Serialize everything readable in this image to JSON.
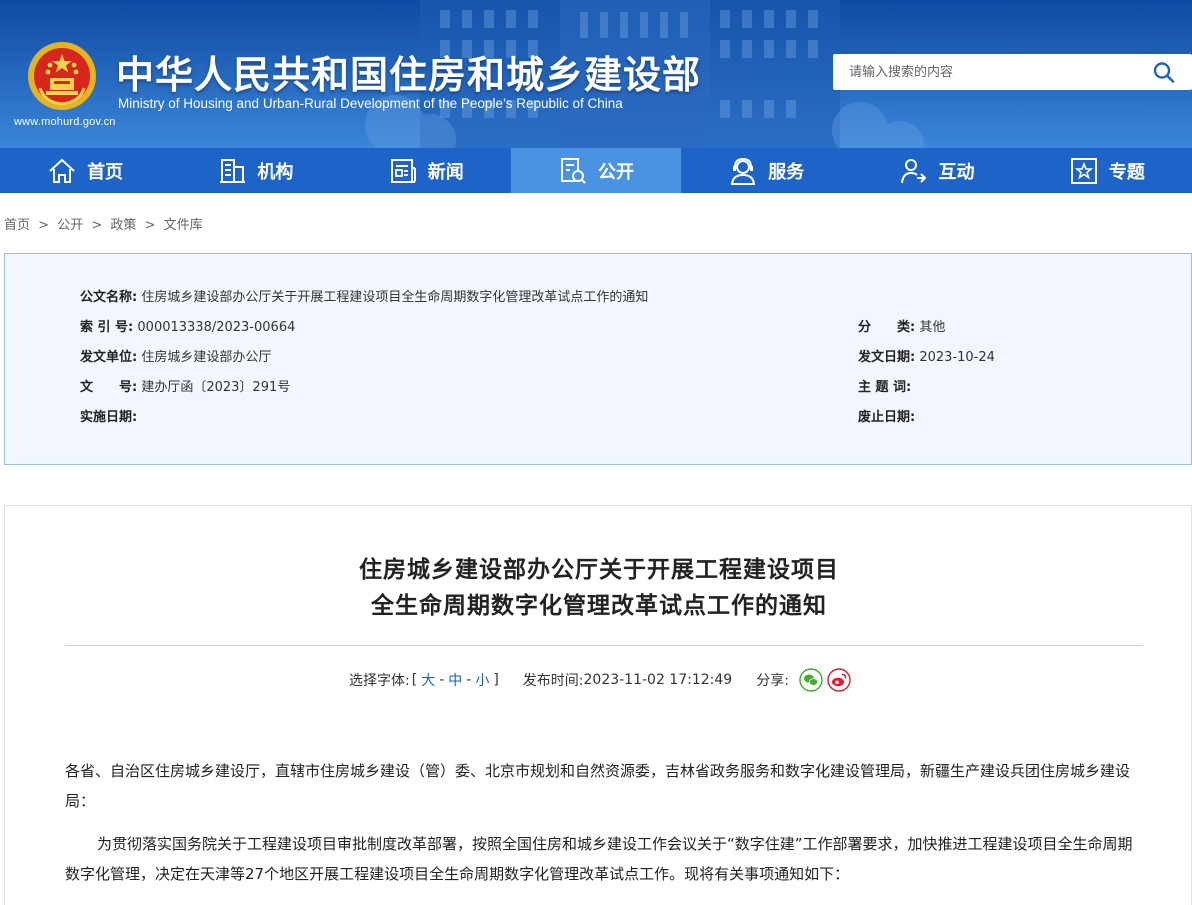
{
  "header": {
    "title_cn": "中华人民共和国住房和城乡建设部",
    "title_en": "Ministry of Housing and Urban-Rural Development of the People’s Republic of China",
    "site_url": "www.mohurd.gov.cn",
    "search_placeholder": "请输入搜索的内容"
  },
  "nav": {
    "items": [
      {
        "label": "首页",
        "icon": "home-icon"
      },
      {
        "label": "机构",
        "icon": "building-icon"
      },
      {
        "label": "新闻",
        "icon": "newspaper-icon"
      },
      {
        "label": "公开",
        "icon": "document-search-icon",
        "active": true
      },
      {
        "label": "服务",
        "icon": "service-person-icon"
      },
      {
        "label": "互动",
        "icon": "interaction-person-icon"
      },
      {
        "label": "专题",
        "icon": "star-box-icon"
      }
    ]
  },
  "breadcrumb": [
    "首页",
    ">",
    "公开",
    ">",
    "政策",
    ">",
    "文件库"
  ],
  "info": {
    "name_label": "公文名称:",
    "name_value": "住房城乡建设部办公厅关于开展工程建设项目全生命周期数字化管理改革试点工作的通知",
    "index_label": "索 引 号:",
    "index_value": "000013338/2023-00664",
    "category_label": "分　　类:",
    "category_value": "其他",
    "issuer_label": "发文单位:",
    "issuer_value": "住房城乡建设部办公厅",
    "date_label": "发文日期:",
    "date_value": "2023-10-24",
    "docno_label": "文　　号:",
    "docno_value": "建办厅函〔2023〕291号",
    "keywords_label": "主 题 词:",
    "keywords_value": "",
    "effective_label": "实施日期:",
    "effective_value": "",
    "expire_label": "废止日期:",
    "expire_value": ""
  },
  "article": {
    "title_line1": "住房城乡建设部办公厅关于开展工程建设项目",
    "title_line2": "全生命周期数字化管理改革试点工作的通知",
    "font_select_label": "选择字体:",
    "bracket_open": "[",
    "font_large": "大",
    "font_medium": "中",
    "font_small": "小",
    "dash": "-",
    "bracket_close": "]",
    "publish_label": "发布时间:",
    "publish_time": "2023-11-02 17:12:49",
    "share_label": "分享:",
    "para1": "各省、自治区住房城乡建设厅，直辖市住房城乡建设（管）委、北京市规划和自然资源委，吉林省政务服务和数字化建设管理局，新疆生产建设兵团住房城乡建设局：",
    "para2": "为贯彻落实国务院关于工程建设项目审批制度改革部署，按照全国住房和城乡建设工作会议关于“数字住建”工作部署要求，加快推进工程建设项目全生命周期数字化管理，决定在天津等27个地区开展工程建设项目全生命周期数字化管理改革试点工作。现将有关事项通知如下："
  },
  "colors": {
    "nav_bg": "#1d63c8",
    "nav_active": "#4a92e2",
    "link_blue": "#1d63c8",
    "infobox_bg": "#f2f7fd",
    "infobox_border": "#9fbfe2",
    "wechat_green": "#3fae29",
    "weibo_red": "#e6162d"
  }
}
